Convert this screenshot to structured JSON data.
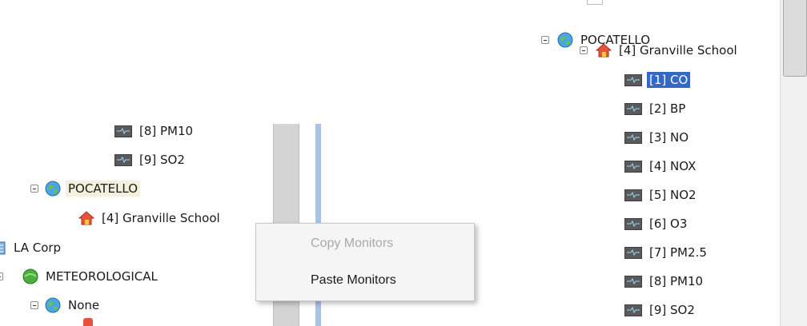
{
  "left_tree": {
    "items": [
      {
        "label": "[8] PM10"
      },
      {
        "label": "[9] SO2"
      },
      {
        "label": "POCATELLO"
      },
      {
        "label": "[4] Granville School"
      },
      {
        "label": "LA Corp"
      },
      {
        "label": "METEOROLOGICAL"
      },
      {
        "label": "None"
      }
    ]
  },
  "context_menu": {
    "items": [
      {
        "label": "Copy Monitors",
        "state": "disabled"
      },
      {
        "label": "Paste Monitors",
        "state": "enabled"
      }
    ]
  },
  "right_tree": {
    "root": "POCATELLO",
    "site": "[4] Granville School",
    "monitors": [
      {
        "label": "[1] CO",
        "selected": true
      },
      {
        "label": "[2] BP"
      },
      {
        "label": "[3] NO"
      },
      {
        "label": "[4] NOX"
      },
      {
        "label": "[5] NO2"
      },
      {
        "label": "[6] O3"
      },
      {
        "label": "[7] PM2.5"
      },
      {
        "label": "[8] PM10"
      },
      {
        "label": "[9] SO2"
      }
    ]
  },
  "colors": {
    "selection": "#3368c8",
    "splitter_accent": "#a9c2e8"
  }
}
